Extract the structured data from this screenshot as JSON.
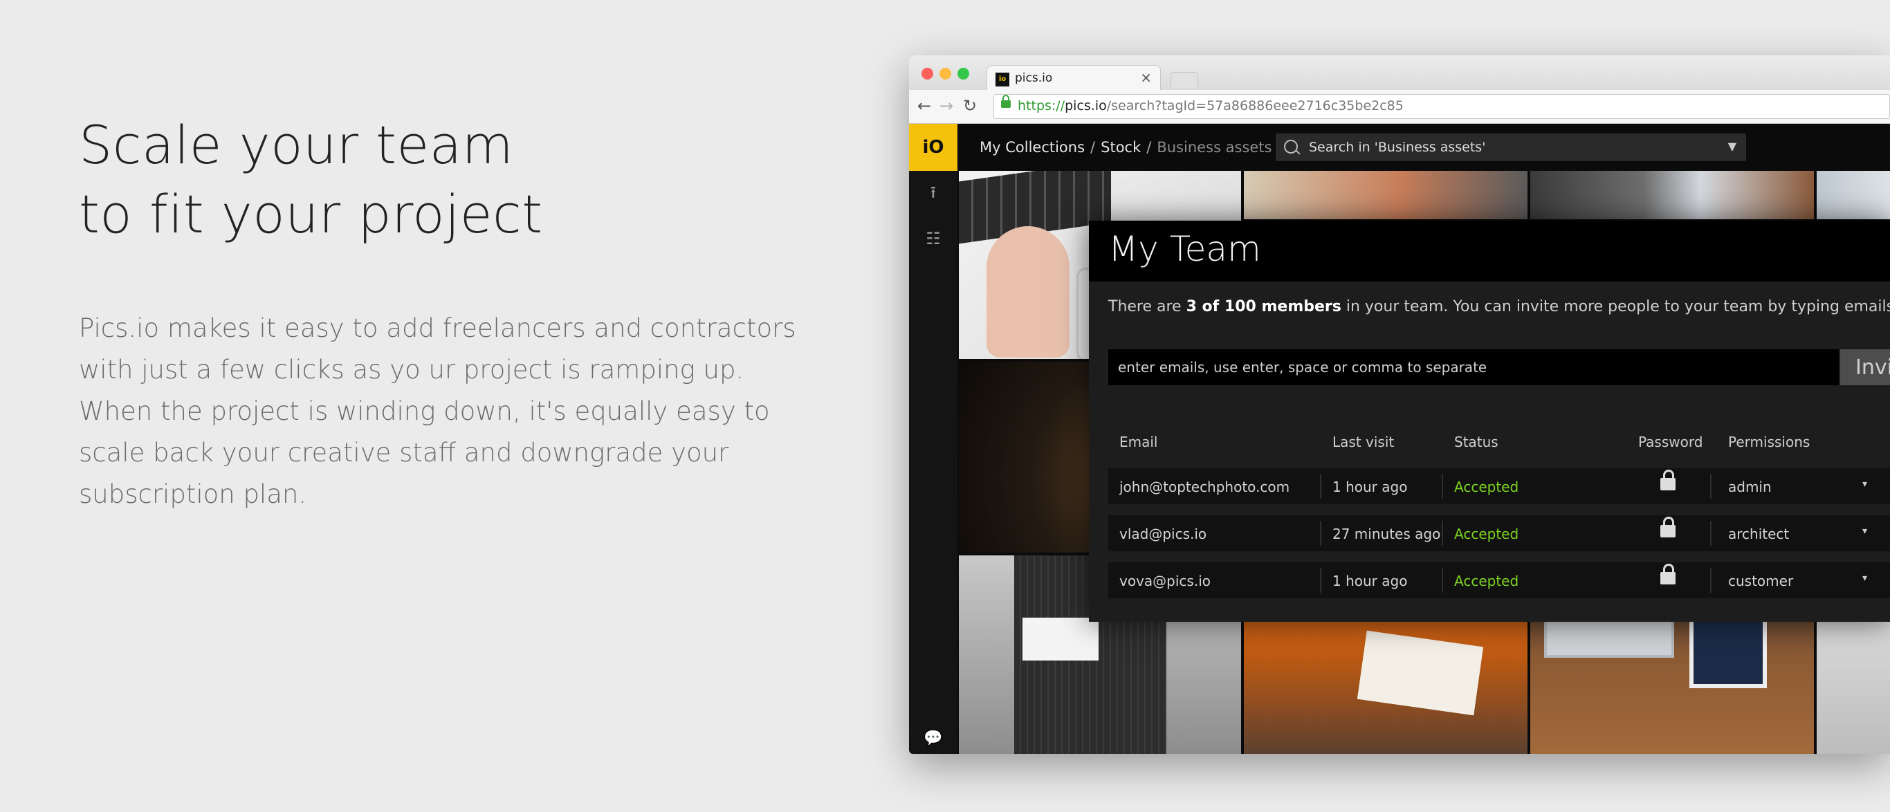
{
  "hero": {
    "headline_lines": [
      "Scale your team",
      "to fit your project"
    ],
    "body_lines": [
      "Pics.io makes it easy to add freelancers and contractors",
      "with just a few clicks as yo ur project is ramping up.",
      "When the project is winding down, it's equally easy to",
      "scale back your creative staff and downgrade your",
      "subscription plan."
    ]
  },
  "browser": {
    "tab_title": "pics.io",
    "tab_favicon": "io",
    "tab_close": "×",
    "url_scheme": "https://",
    "url_host": "pics.io",
    "url_path": "/search?tagId=57a86886eee2716c35be2c85",
    "nav_back": "←",
    "nav_forward": "→",
    "nav_reload": "↻"
  },
  "app": {
    "logo": "iO",
    "sidebar_icons": {
      "upload": "⭱",
      "tree": "☷",
      "chat": "💬"
    },
    "breadcrumb": {
      "item1": "My Collections",
      "item2": "Stock",
      "current": "Business assets",
      "separator": "/"
    },
    "search": {
      "text": "Search in 'Business assets'",
      "caret": "▼"
    }
  },
  "modal": {
    "title": "My Team",
    "info": {
      "prefix": "There are ",
      "bold": "3 of 100 members",
      "suffix": " in your team. You can invite more people to your team by typing emails in field belo"
    },
    "invite_placeholder": "enter emails, use enter, space or comma to separate",
    "invite_button": "Invi",
    "columns": {
      "email": "Email",
      "last_visit": "Last visit",
      "status": "Status",
      "password": "Password",
      "permissions": "Permissions"
    },
    "rows": [
      {
        "email": "john@toptechphoto.com",
        "last_visit": "1 hour ago",
        "status": "Accepted",
        "permission": "admin"
      },
      {
        "email": "vlad@pics.io",
        "last_visit": "27 minutes ago",
        "status": "Accepted",
        "permission": "architect"
      },
      {
        "email": "vova@pics.io",
        "last_visit": "1 hour ago",
        "status": "Accepted",
        "permission": "customer"
      }
    ],
    "dropdown_caret": "▾"
  },
  "colors": {
    "brand_yellow": "#f4c20d",
    "status_green": "#7ed321",
    "page_bg": "#ebebeb"
  },
  "icons": [
    "search-icon",
    "lock-icon",
    "upload-icon",
    "tree-icon",
    "chat-icon",
    "close-icon",
    "back-arrow-icon",
    "forward-arrow-icon",
    "reload-icon",
    "chevron-down-icon"
  ]
}
